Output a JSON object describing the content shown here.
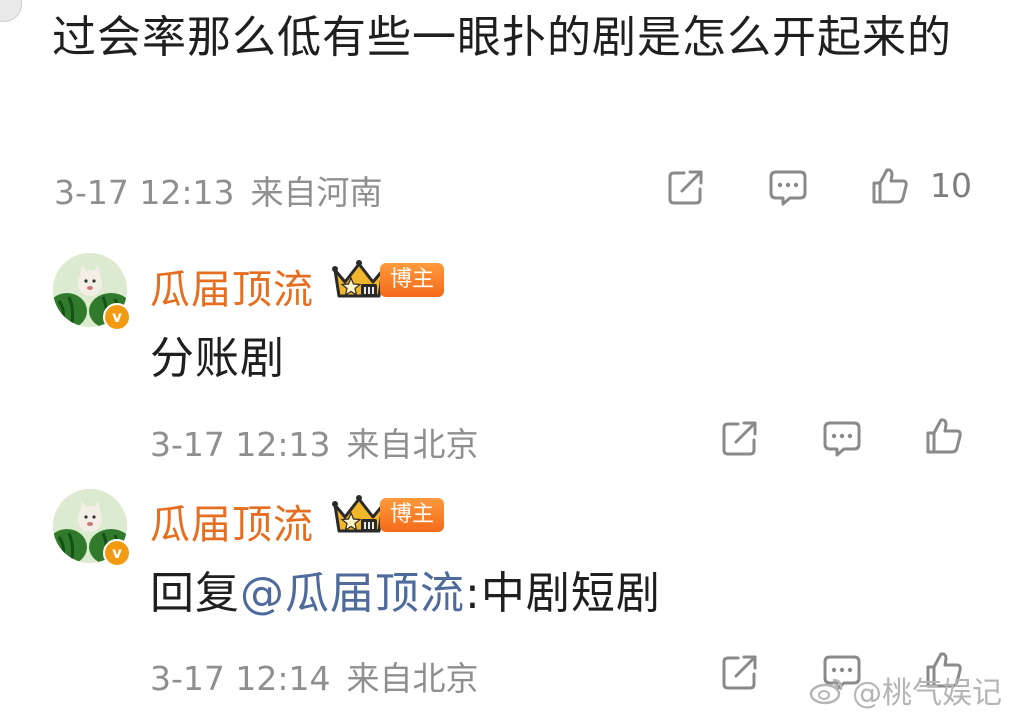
{
  "main_comment": {
    "text": "过会率那么低有些一眼扑的剧是怎么开起来的",
    "time": "3-17 12:13",
    "location": "来自河南",
    "like_count": "10"
  },
  "replies": [
    {
      "username": "瓜届顶流",
      "badge": "博主",
      "verified_mark": "v",
      "text": "分账剧",
      "time": "3-17 12:13",
      "location": "来自北京"
    },
    {
      "username": "瓜届顶流",
      "badge": "博主",
      "verified_mark": "v",
      "reply_prefix": "回复",
      "mention": "@瓜届顶流",
      "text": ":中剧短剧",
      "time": "3-17 12:14",
      "location": "来自北京"
    }
  ],
  "watermark": {
    "text": "@桃气娱记"
  },
  "colors": {
    "username": "#e66e20",
    "mention": "#4f6a9c",
    "meta": "#8f8f8f",
    "badge": "#f46a1a"
  },
  "icons": [
    "share-icon",
    "comment-icon",
    "like-icon",
    "crown-level-icon",
    "weibo-logo-icon"
  ]
}
